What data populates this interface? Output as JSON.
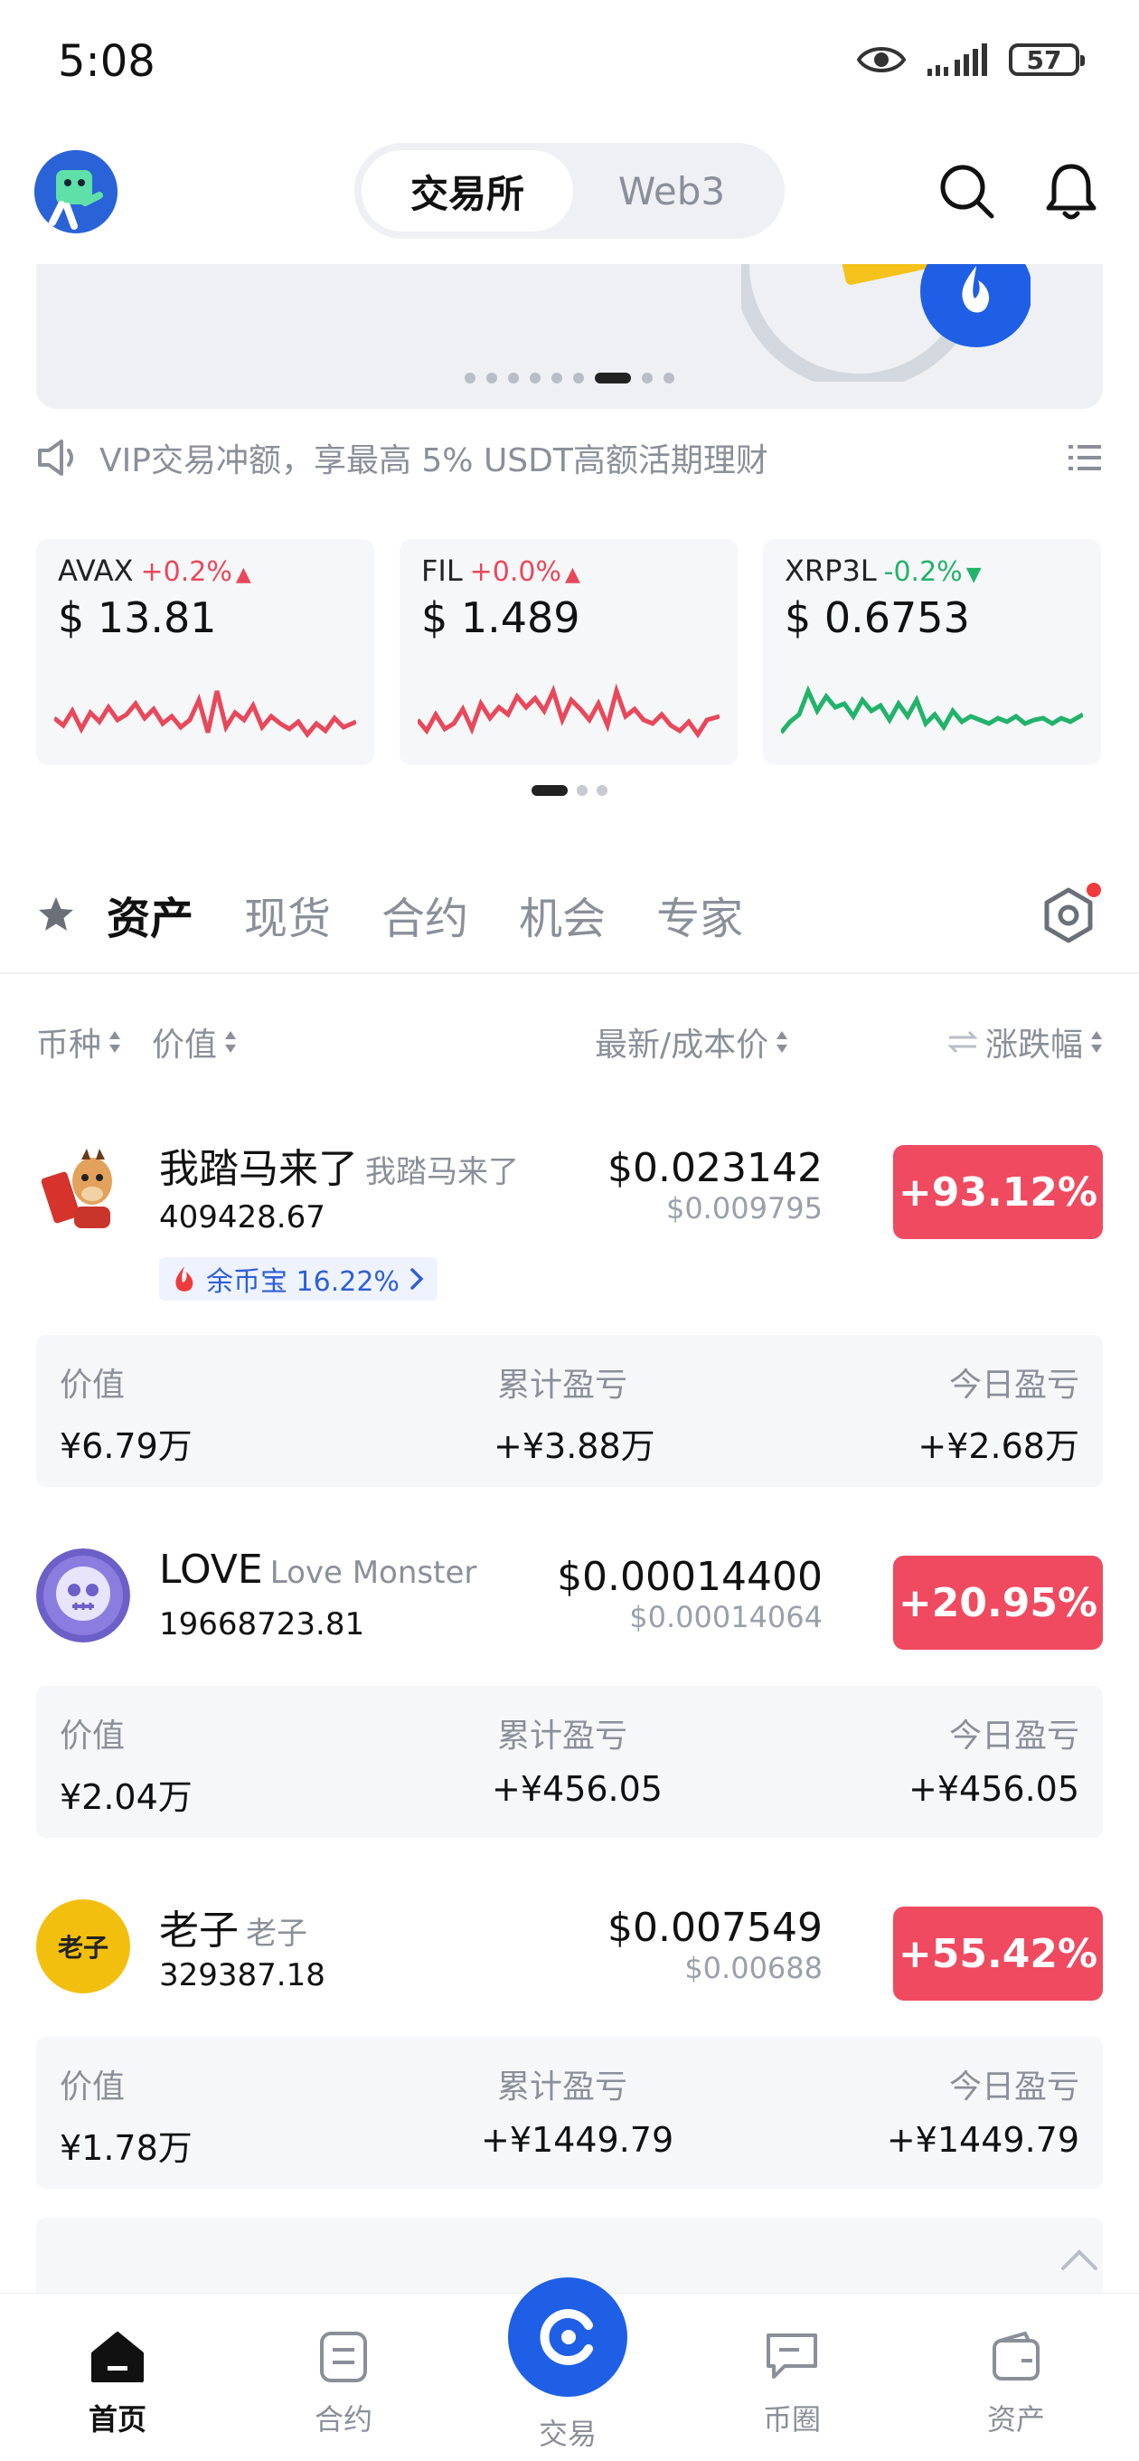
{
  "status": {
    "time": "5:08",
    "battery": "57"
  },
  "header": {
    "seg_active": "交易所",
    "seg_inactive": "Web3"
  },
  "notice": {
    "text": "VIP交易冲额，享最高 5% USDT高额活期理财"
  },
  "tickers": [
    {
      "name": "AVAX",
      "change": "+0.2%",
      "price": "$ 13.81",
      "dir": "up"
    },
    {
      "name": "FIL",
      "change": "+0.0%",
      "price": "$ 1.489",
      "dir": "up"
    },
    {
      "name": "XRP3L",
      "change": "-0.2%",
      "price": "$ 0.6753",
      "dir": "down"
    }
  ],
  "tabs": [
    "资产",
    "现货",
    "合约",
    "机会",
    "专家"
  ],
  "columns": {
    "coin": "币种",
    "value": "价值",
    "price": "最新/成本价",
    "change": "涨跌幅"
  },
  "assets": [
    {
      "name": "我踏马来了",
      "sub": "我踏马来了",
      "qty": "409428.67",
      "price": "$0.023142",
      "cost": "$0.009795",
      "change": "+93.12%",
      "earn": "余币宝 16.22%",
      "value_label": "价值",
      "value": "¥6.79万",
      "pnl_label": "累计盈亏",
      "pnl": "+¥3.88万",
      "today_label": "今日盈亏",
      "today": "+¥2.68万"
    },
    {
      "name": "LOVE",
      "sub": "Love Monster",
      "qty": "19668723.81",
      "price": "$0.00014400",
      "cost": "$0.00014064",
      "change": "+20.95%",
      "value_label": "价值",
      "value": "¥2.04万",
      "pnl_label": "累计盈亏",
      "pnl": "+¥456.05",
      "today_label": "今日盈亏",
      "today": "+¥456.05"
    },
    {
      "name": "老子",
      "sub": "老子",
      "qty": "329387.18",
      "icon_text": "老子",
      "price": "$0.007549",
      "cost": "$0.00688",
      "change": "+55.42%",
      "value_label": "价值",
      "value": "¥1.78万",
      "pnl_label": "累计盈亏",
      "pnl": "+¥1449.79",
      "today_label": "今日盈亏",
      "today": "+¥1449.79"
    }
  ],
  "nav": [
    "首页",
    "合约",
    "交易",
    "币圈",
    "资产"
  ],
  "colors": {
    "up": "#e8485b",
    "down": "#21b36a",
    "accent": "#1f5fe6",
    "badge": "#ef4a60"
  }
}
